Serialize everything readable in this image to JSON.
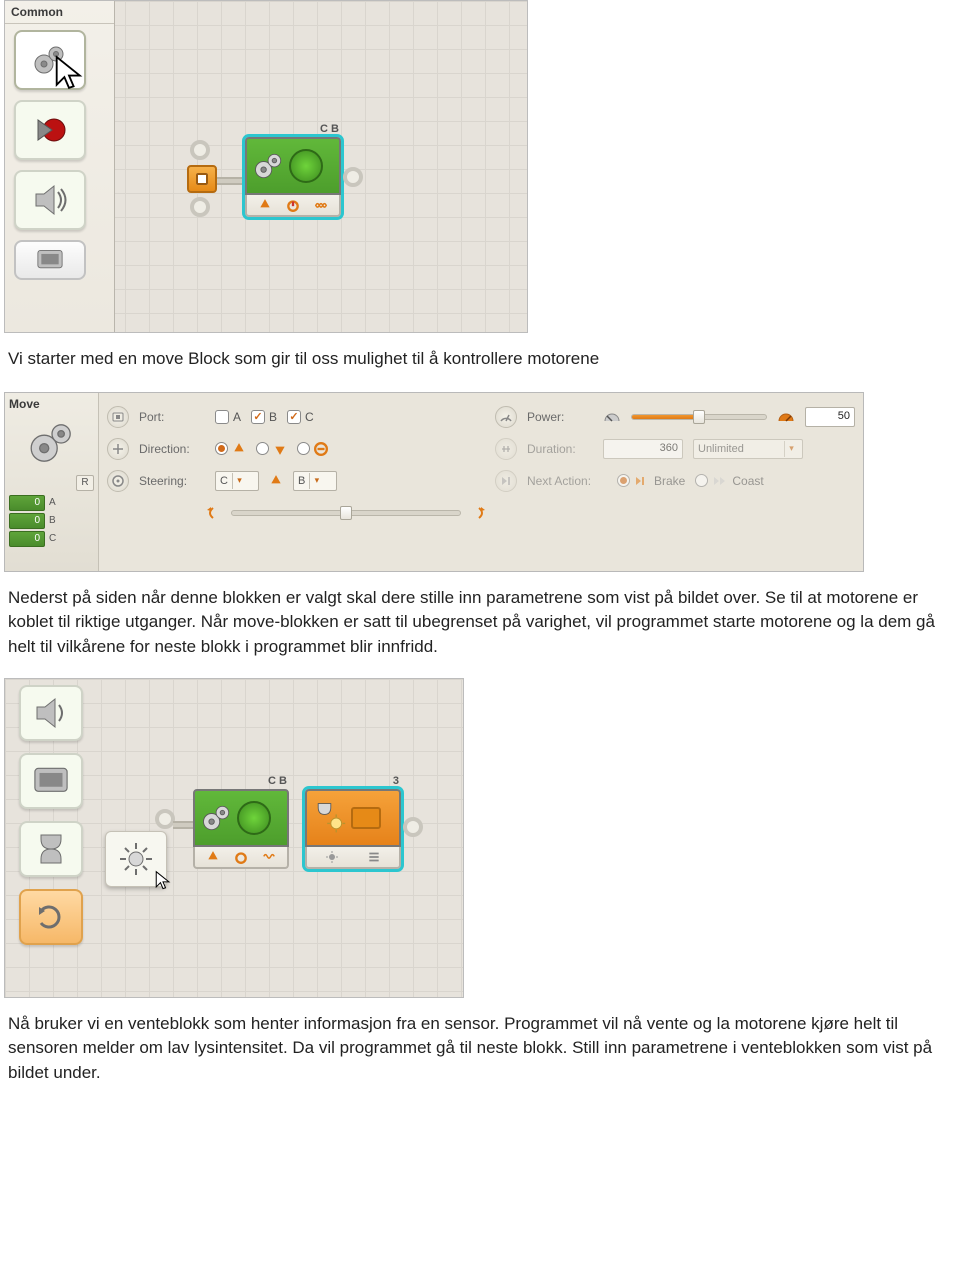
{
  "shot1": {
    "palette_title": "Common",
    "move_block_corner": "C B"
  },
  "para1": "Vi starter med en move Block som gir til oss mulighet til å kontrollere motorene",
  "shot2": {
    "title": "Move",
    "ports_readout": {
      "r_tab": "R",
      "a_val": "0",
      "a_lbl": "A",
      "b_val": "0",
      "b_lbl": "B",
      "c_val": "0",
      "c_lbl": "C"
    },
    "port_label": "Port:",
    "port_a": "A",
    "port_b": "B",
    "port_c": "C",
    "direction_label": "Direction:",
    "steering_label": "Steering:",
    "steer_left": "C",
    "steer_right": "B",
    "power_label": "Power:",
    "power_value": "50",
    "duration_label": "Duration:",
    "duration_value": "360",
    "duration_mode": "Unlimited",
    "next_action_label": "Next Action:",
    "brake": "Brake",
    "coast": "Coast"
  },
  "para2": "Nederst på siden når denne blokken er valgt skal dere stille inn parametrene som vist på bildet over. Se til at motorene er koblet til riktige utganger. Når move-blokken er satt til ubegrenset på varighet, vil programmet starte motorene og la dem gå helt til vilkårene for neste blokk i programmet blir innfridd.",
  "shot3": {
    "move_block_corner": "C B",
    "wait_block_corner": "3"
  },
  "para3": "Nå bruker vi en venteblokk som henter informasjon fra en sensor. Programmet vil nå vente og la motorene kjøre helt til sensoren melder om lav lysintensitet. Da vil programmet gå til neste blokk. Still inn parametrene i venteblokken som vist på bildet under."
}
